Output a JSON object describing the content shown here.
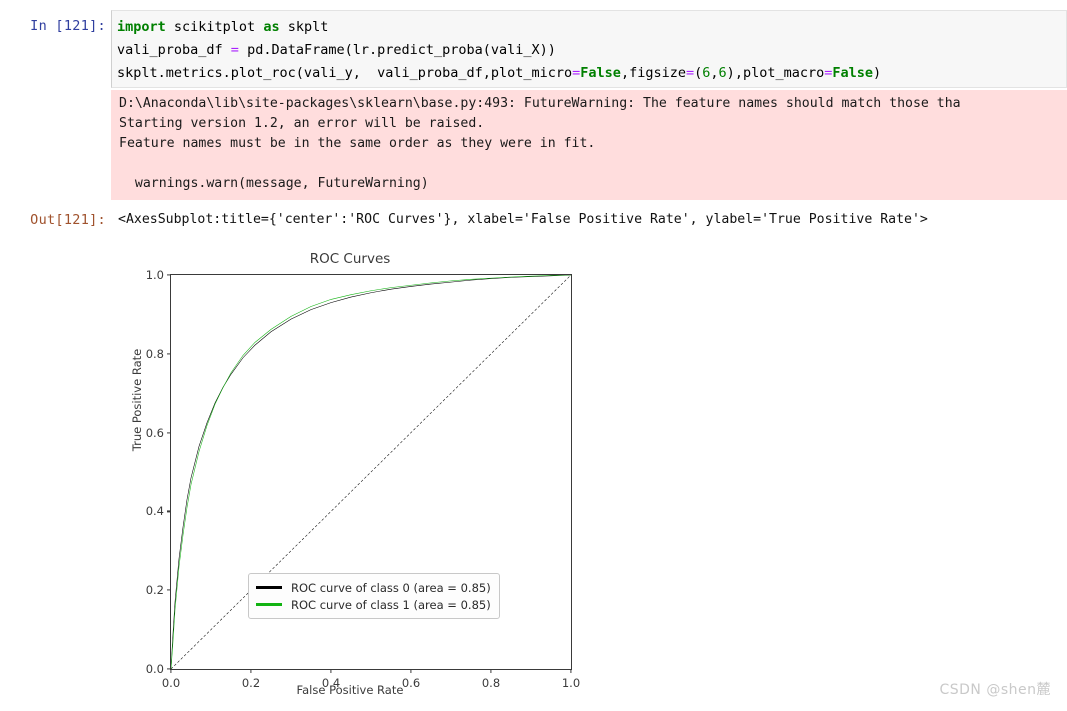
{
  "notebook": {
    "input_prompt": "In  [121]:",
    "output_prompt": "Out[121]:",
    "code_lines": [
      "import scikitplot as skplt",
      "vali_proba_df = pd.DataFrame(lr.predict_proba(vali_X))",
      "skplt.metrics.plot_roc(vali_y,  vali_proba_df,plot_micro=False,figsize=(6,6),plot_macro=False)"
    ],
    "code_tokens": {
      "l1_kw_import": "import",
      "l1_mod": " scikitplot ",
      "l1_kw_as": "as",
      "l1_alias": " skplt",
      "l2_a": "vali_proba_df ",
      "l2_eq": "=",
      "l2_b": " pd.DataFrame(lr.predict_proba(vali_X))",
      "l3_a": "skplt.metrics.plot_roc(vali_y,  vali_proba_df,plot_micro",
      "l3_eq1": "=",
      "l3_false1": "False",
      "l3_b": ",figsize",
      "l3_eq2": "=",
      "l3_paren_open": "(",
      "l3_n1": "6",
      "l3_comma": ",",
      "l3_n2": "6",
      "l3_paren_close": ")",
      "l3_c": ",plot_macro",
      "l3_eq3": "=",
      "l3_false2": "False",
      "l3_d": ")"
    },
    "warning_lines": [
      "D:\\Anaconda\\lib\\site-packages\\sklearn\\base.py:493: FutureWarning: The feature names should match those tha",
      "Starting version 1.2, an error will be raised.",
      "Feature names must be in the same order as they were in fit.",
      "  warnings.warn(message, FutureWarning)"
    ],
    "output_text": "<AxesSubplot:title={'center':'ROC Curves'}, xlabel='False Positive Rate', ylabel='True Positive Rate'>"
  },
  "watermark": "CSDN @shen麓",
  "colors": {
    "class0": "#000000",
    "class1": "#12b312",
    "chance": "#000000",
    "prompt_in": "#303f9f",
    "prompt_out": "#a0522d",
    "warning_bg": "#ffdddd",
    "code_bg": "#f7f7f7"
  },
  "chart_data": {
    "type": "line",
    "title": "ROC Curves",
    "xlabel": "False Positive Rate",
    "ylabel": "True Positive Rate",
    "xlim": [
      0.0,
      1.0
    ],
    "ylim": [
      0.0,
      1.0
    ],
    "xticks": [
      "0.0",
      "0.2",
      "0.4",
      "0.6",
      "0.8",
      "1.0"
    ],
    "yticks": [
      "0.0",
      "0.2",
      "0.4",
      "0.6",
      "0.8",
      "1.0"
    ],
    "xtick_values": [
      0.0,
      0.2,
      0.4,
      0.6,
      0.8,
      1.0
    ],
    "ytick_values": [
      0.0,
      0.2,
      0.4,
      0.6,
      0.8,
      1.0
    ],
    "grid": false,
    "legend_position": "lower right",
    "legend": [
      {
        "label": "ROC curve of class 0 (area = 0.85)",
        "color": "#000000",
        "area": 0.85
      },
      {
        "label": "ROC curve of class 1 (area = 0.85)",
        "color": "#12b312",
        "area": 0.85
      }
    ],
    "series": [
      {
        "name": "ROC curve of class 0 (area = 0.85)",
        "color": "#000000",
        "area": 0.85,
        "x": [
          0.0,
          0.005,
          0.01,
          0.02,
          0.03,
          0.04,
          0.05,
          0.07,
          0.09,
          0.11,
          0.13,
          0.15,
          0.18,
          0.21,
          0.25,
          0.3,
          0.35,
          0.4,
          0.45,
          0.5,
          0.55,
          0.6,
          0.65,
          0.7,
          0.75,
          0.8,
          0.85,
          0.9,
          0.95,
          1.0
        ],
        "y": [
          0.0,
          0.09,
          0.17,
          0.28,
          0.36,
          0.43,
          0.485,
          0.565,
          0.625,
          0.675,
          0.715,
          0.748,
          0.79,
          0.822,
          0.856,
          0.888,
          0.912,
          0.93,
          0.944,
          0.955,
          0.964,
          0.971,
          0.977,
          0.982,
          0.987,
          0.991,
          0.994,
          0.996,
          0.998,
          1.0
        ]
      },
      {
        "name": "ROC curve of class 1 (area = 0.85)",
        "color": "#12b312",
        "area": 0.85,
        "x": [
          0.0,
          0.005,
          0.01,
          0.02,
          0.03,
          0.04,
          0.05,
          0.07,
          0.09,
          0.11,
          0.13,
          0.15,
          0.18,
          0.21,
          0.25,
          0.3,
          0.35,
          0.4,
          0.45,
          0.5,
          0.55,
          0.6,
          0.65,
          0.7,
          0.75,
          0.8,
          0.85,
          0.9,
          0.95,
          1.0
        ],
        "y": [
          0.0,
          0.07,
          0.15,
          0.26,
          0.34,
          0.41,
          0.468,
          0.552,
          0.618,
          0.672,
          0.714,
          0.752,
          0.796,
          0.829,
          0.862,
          0.895,
          0.92,
          0.938,
          0.95,
          0.96,
          0.968,
          0.974,
          0.98,
          0.985,
          0.989,
          0.992,
          0.995,
          0.997,
          0.999,
          1.0
        ]
      },
      {
        "name": "chance-diagonal",
        "color": "#000000",
        "style": "dashed",
        "x": [
          0.0,
          1.0
        ],
        "y": [
          0.0,
          1.0
        ]
      }
    ]
  }
}
